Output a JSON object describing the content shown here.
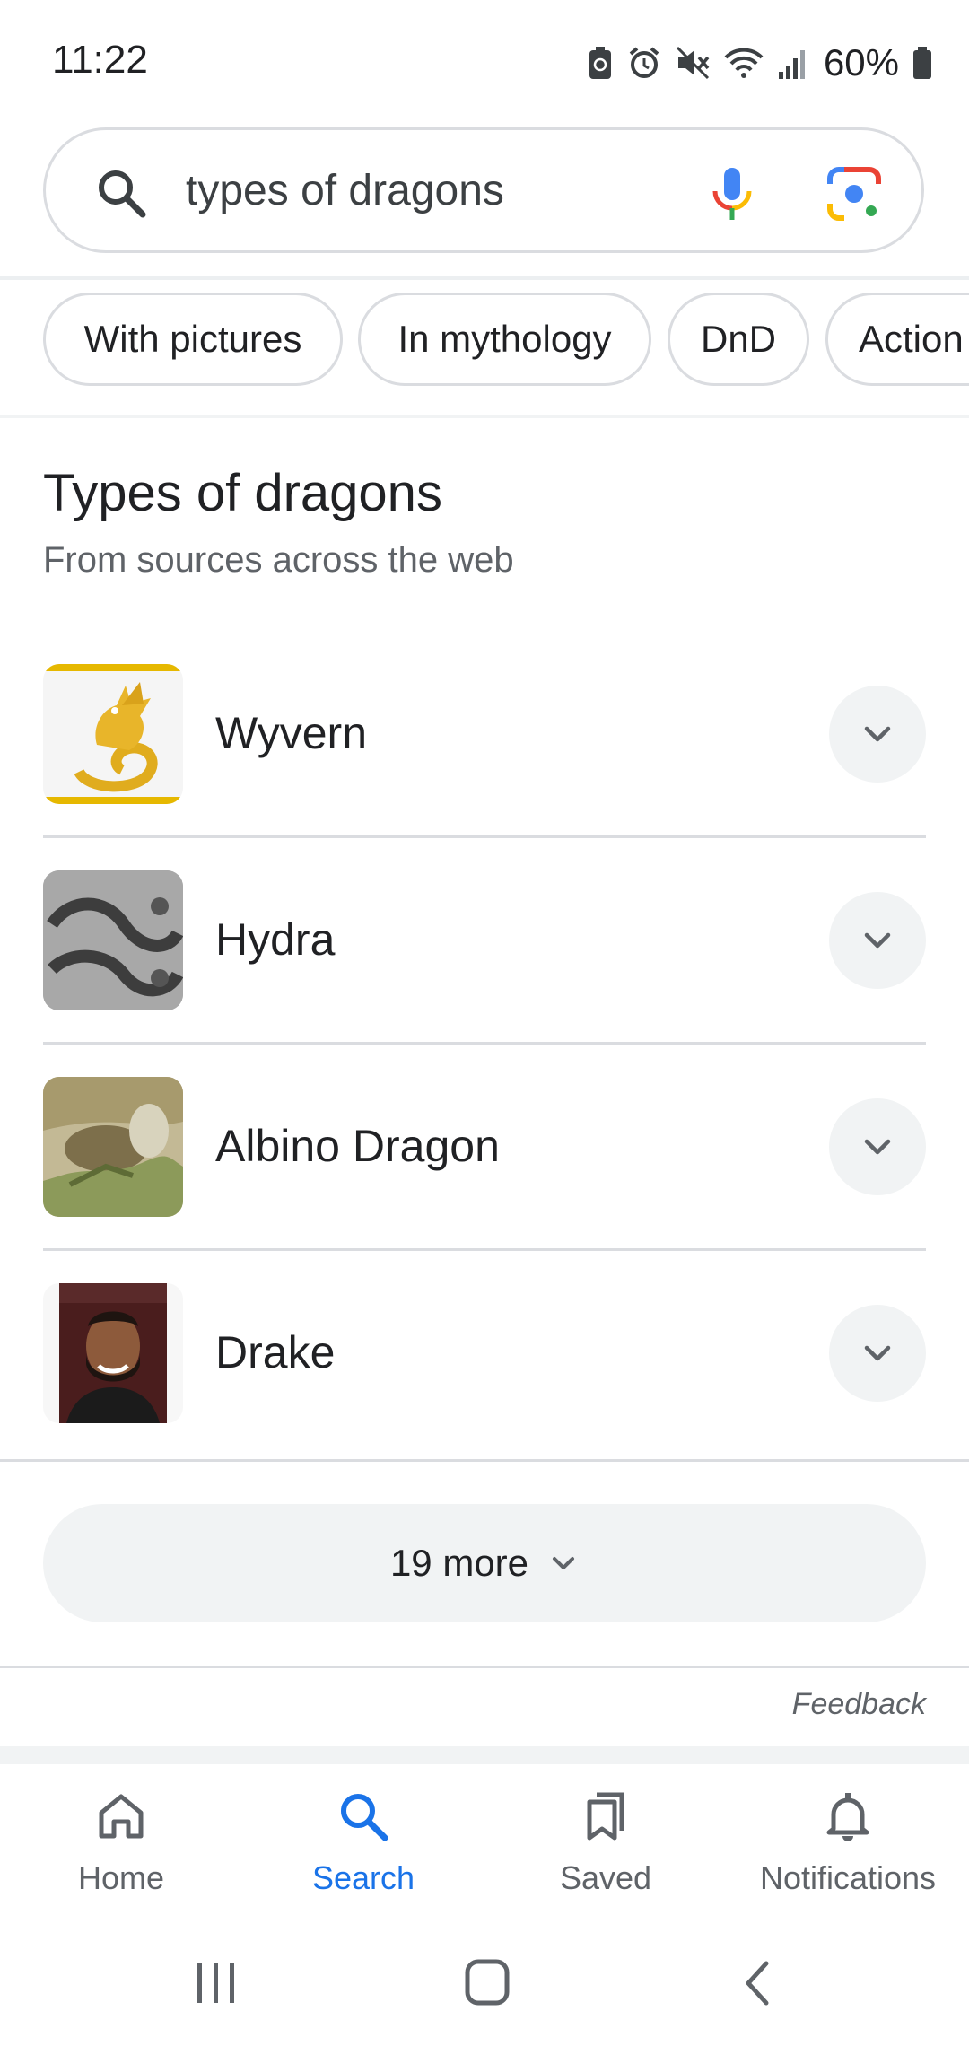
{
  "status_bar": {
    "time": "11:22",
    "battery": "60%",
    "icons": [
      "battery-saver-icon",
      "alarm-icon",
      "mute-icon",
      "wifi-icon",
      "signal-icon",
      "battery-icon"
    ]
  },
  "search": {
    "query": "types of dragons",
    "icons": [
      "search-icon",
      "microphone-icon",
      "google-lens-icon"
    ]
  },
  "chips": [
    "With pictures",
    "In mythology",
    "DnD",
    "Action"
  ],
  "section": {
    "title": "Types of dragons",
    "subtitle": "From sources across the web",
    "items": [
      {
        "label": "Wyvern"
      },
      {
        "label": "Hydra"
      },
      {
        "label": "Albino Dragon"
      },
      {
        "label": "Drake"
      }
    ],
    "more_label": "19 more",
    "feedback": "Feedback"
  },
  "bottom_nav": {
    "items": [
      {
        "label": "Home",
        "icon": "home-icon"
      },
      {
        "label": "Search",
        "icon": "search-icon"
      },
      {
        "label": "Saved",
        "icon": "bookmark-icon"
      },
      {
        "label": "Notifications",
        "icon": "bell-icon"
      }
    ],
    "active": "Search"
  },
  "colors": {
    "accent": "#1a73e8",
    "text": "#202124",
    "secondary_text": "#5f6368",
    "border": "#dadce0",
    "surface": "#f1f3f4"
  }
}
